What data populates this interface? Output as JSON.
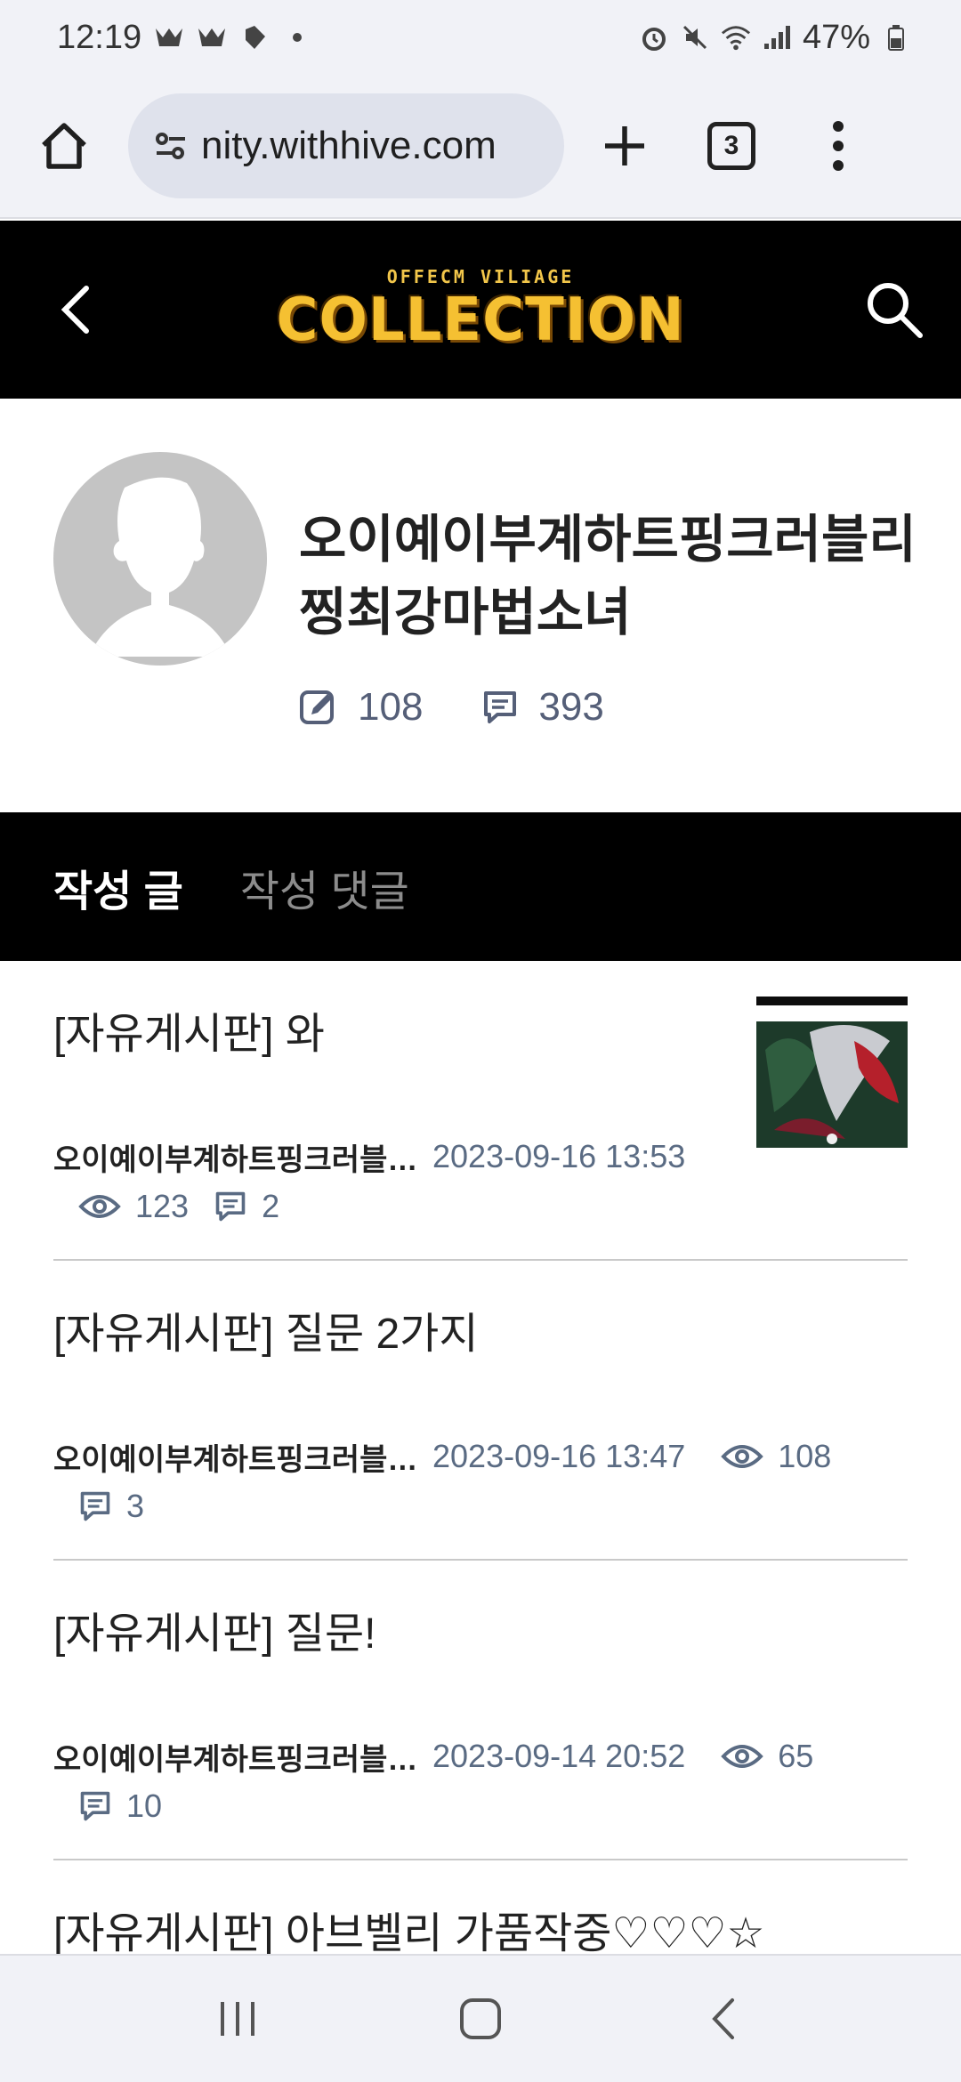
{
  "status_bar": {
    "time": "12:19",
    "battery": "47%"
  },
  "browser": {
    "url": "nity.withhive.com",
    "tab_count": "3"
  },
  "site": {
    "logo_small": "OFFECM VILIAGE",
    "logo_big": "COLLECTION"
  },
  "profile": {
    "name": "오이예이부계하트핑크러블리찡최강마법소녀",
    "post_count": "108",
    "comment_count": "393"
  },
  "tabs": [
    {
      "label": "작성 글"
    },
    {
      "label": "작성 댓글"
    }
  ],
  "posts": [
    {
      "title": "[자유게시판] 와",
      "author": "오이예이부계하트핑크러블리찡최강마법소녀",
      "date": "2023-09-16 13:53",
      "views": "123",
      "comments": "2",
      "has_thumbnail": true
    },
    {
      "title": "[자유게시판] 질문 2가지",
      "author": "오이예이부계하트핑크러블리찡최강마법소녀",
      "date": "2023-09-16 13:47",
      "views": "108",
      "comments": "3",
      "has_thumbnail": false
    },
    {
      "title": "[자유게시판] 질문!",
      "author": "오이예이부계하트핑크러블리찡최강마법소녀",
      "date": "2023-09-14 20:52",
      "views": "65",
      "comments": "10",
      "has_thumbnail": false
    },
    {
      "title": "[자유게시판] 아브벨리 가품작중♡♡♡☆",
      "author": "",
      "date": "",
      "views": "",
      "comments": "",
      "has_thumbnail": false
    }
  ],
  "colors": {
    "header_bg": "#000000",
    "logo_gold": "#f5c032",
    "meta_text": "#5a6b83",
    "avatar_gray": "#c4c4c4"
  }
}
